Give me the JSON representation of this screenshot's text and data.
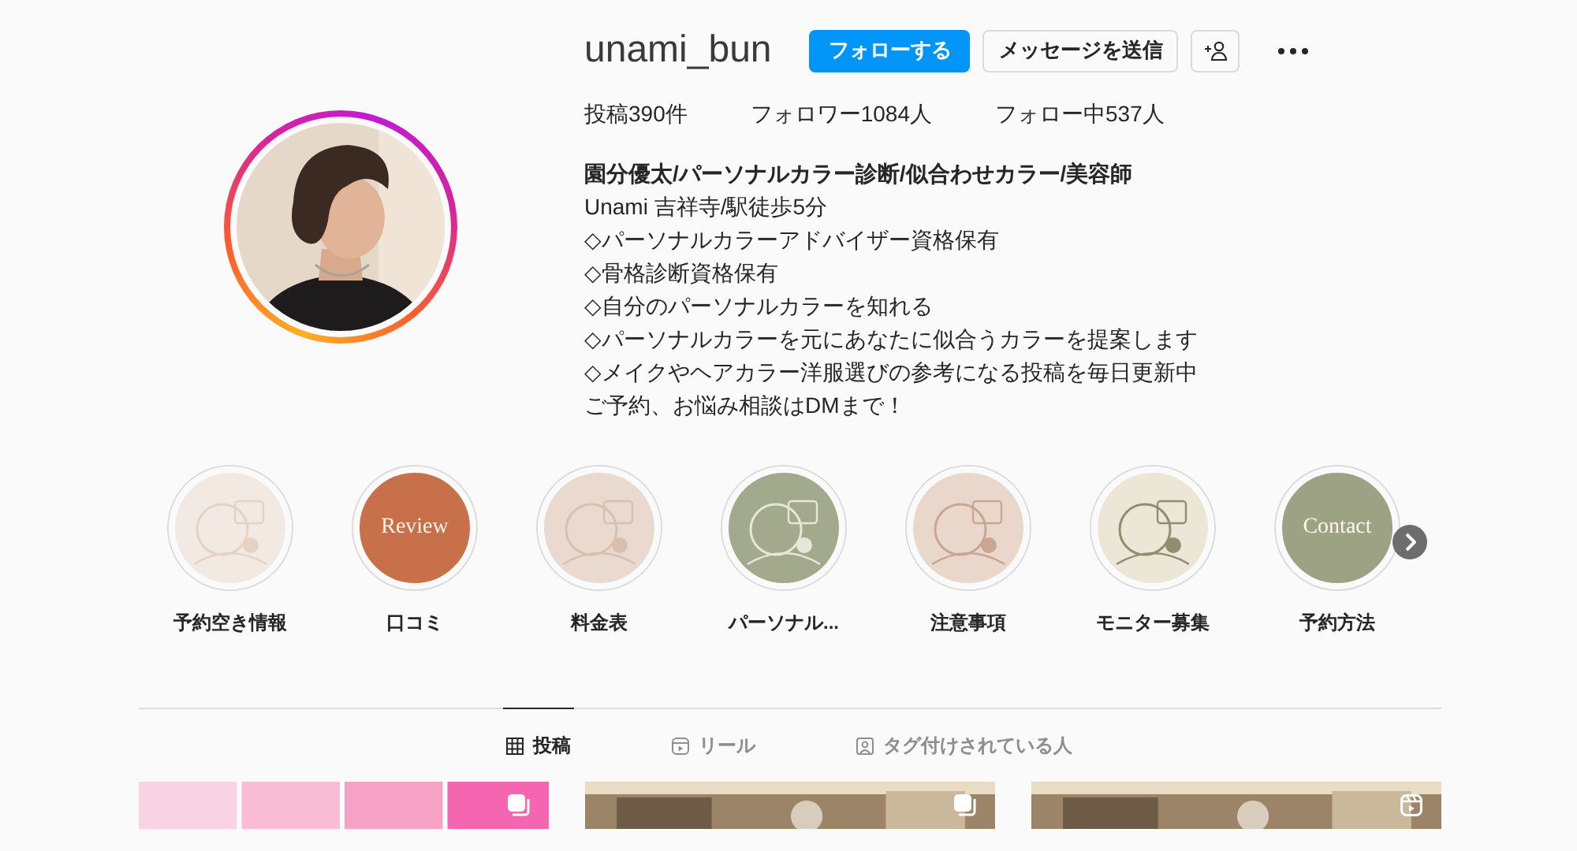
{
  "profile": {
    "username": "unami_bun",
    "story_ring": true,
    "buttons": [
      {
        "label": "フォローする",
        "kind": "primary"
      },
      {
        "label": "メッセージを送信",
        "kind": "secondary"
      }
    ],
    "stats": [
      {
        "label": "投稿",
        "value": "390件"
      },
      {
        "label": "フォロワー",
        "value": "1084人"
      },
      {
        "label": "フォロー中",
        "value": "537人"
      }
    ],
    "full_name": "園分優太/パーソナルカラー診断/似合わせカラー/美容師",
    "bio": [
      "Unami 吉祥寺/駅徒歩5分",
      "◇パーソナルカラーアドバイザー資格保有",
      "◇骨格診断資格保有",
      "◇自分のパーソナルカラーを知れる",
      "◇パーソナルカラーを元にあなたに似合うカラーを提案します",
      "◇メイクやヘアカラー洋服選びの参考になる投稿を毎日更新中",
      "ご予約、お悩み相談はDMまで！"
    ]
  },
  "highlights": [
    {
      "label": "予約空き情報",
      "kind": "picture"
    },
    {
      "label": "口コミ",
      "kind": "text",
      "cover_text": "Review"
    },
    {
      "label": "料金表",
      "kind": "picture"
    },
    {
      "label": "パーソナル...",
      "kind": "picture"
    },
    {
      "label": "注意事項",
      "kind": "picture"
    },
    {
      "label": "モニター募集",
      "kind": "picture"
    },
    {
      "label": "予約方法",
      "kind": "text",
      "cover_text": "Contact"
    }
  ],
  "tabs": [
    {
      "label": "投稿",
      "selected": true
    },
    {
      "label": "リール",
      "selected": false
    },
    {
      "label": "タグ付けされている人",
      "selected": false
    }
  ],
  "posts": [
    {
      "kind": "carousel"
    },
    {
      "kind": "carousel"
    },
    {
      "kind": "reel"
    }
  ]
}
